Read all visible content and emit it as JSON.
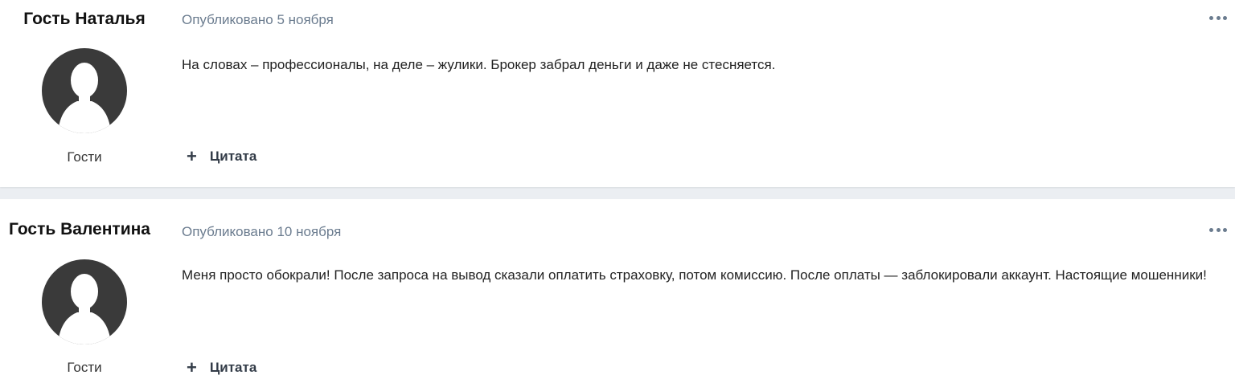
{
  "posts": [
    {
      "author": "Гость Наталья",
      "group": "Гости",
      "date": "Опубликовано 5 ноября",
      "body": "На словах – профессионалы, на деле – жулики. Брокер забрал деньги и даже не стесняется.",
      "quote_label": "Цитата"
    },
    {
      "author": "Гость Валентина",
      "group": "Гости",
      "date": "Опубликовано 10 ноября",
      "body": "Меня просто обокрали! После запроса на вывод сказали оплатить страховку, потом комиссию. После оплаты — заблокировали аккаунт. Настоящие мошенники!",
      "quote_label": "Цитата"
    }
  ],
  "icons": {
    "menu": "ellipsis-icon",
    "quote": "plus-icon",
    "avatar": "default-user-silhouette-icon"
  },
  "colors": {
    "meta_text": "#6b7c8f",
    "page_background": "#ebeef2",
    "avatar_background": "#3a3a3a"
  }
}
